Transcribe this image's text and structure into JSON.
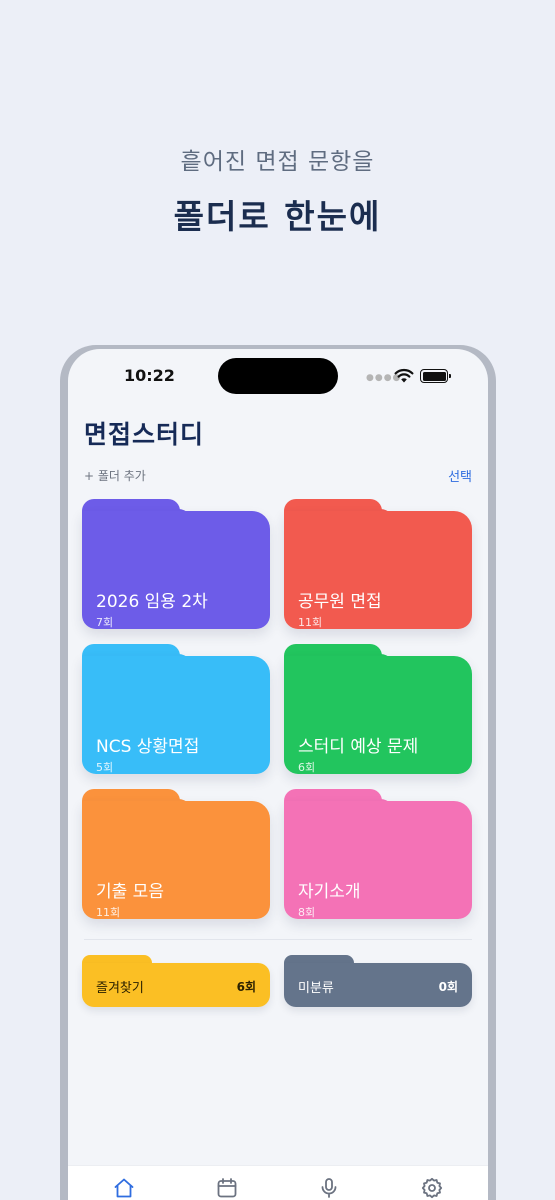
{
  "promo": {
    "subtitle": "흩어진 면접 문항을",
    "title": "폴더로 한눈에"
  },
  "status_bar": {
    "time": "10:22",
    "icons": [
      "cellular-dots-icon",
      "wifi-icon",
      "battery-icon"
    ]
  },
  "app": {
    "title": "면접스터디",
    "add_folder_label": "+ 폴더 추가",
    "select_label": "선택"
  },
  "folders": [
    {
      "name": "2026 임용 2차",
      "count": "7회",
      "color": "#6d5ce8"
    },
    {
      "name": "공무원 면접",
      "count": "11회",
      "color": "#f25a4f"
    },
    {
      "name": "NCS 상황면접",
      "count": "5회",
      "color": "#38bdf8"
    },
    {
      "name": "스터디 예상 문제",
      "count": "6회",
      "color": "#22c55e"
    },
    {
      "name": "기출 모음",
      "count": "11회",
      "color": "#fb923c"
    },
    {
      "name": "자기소개",
      "count": "8회",
      "color": "#f472b6"
    }
  ],
  "special_folders": [
    {
      "name": "즐겨찾기",
      "count": "6회",
      "color": "#fbbf24",
      "text_color": "#2b2100"
    },
    {
      "name": "미분류",
      "count": "0회",
      "color": "#64748b",
      "text_color": "#ffffff"
    }
  ],
  "tab_bar": {
    "items": [
      "home-icon",
      "calendar-icon",
      "microphone-icon",
      "settings-icon"
    ],
    "active": "home-icon",
    "active_color": "#2f6de0",
    "inactive_color": "#6b7280"
  }
}
